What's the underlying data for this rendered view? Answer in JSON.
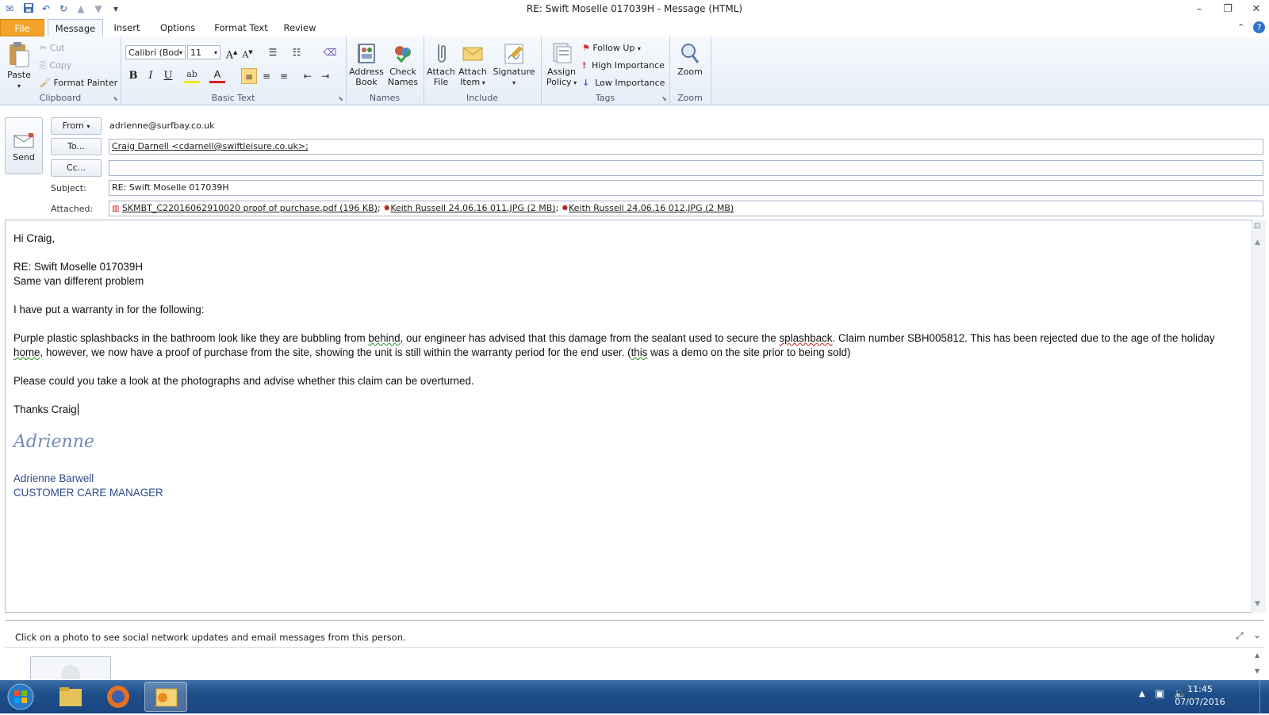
{
  "window": {
    "title": "RE: Swift Moselle 017039H  -  Message (HTML)"
  },
  "ribbon_tabs": [
    {
      "label": "File"
    },
    {
      "label": "Message"
    },
    {
      "label": "Insert"
    },
    {
      "label": "Options"
    },
    {
      "label": "Format Text"
    },
    {
      "label": "Review"
    }
  ],
  "clipboard": {
    "paste": "Paste",
    "cut": "Cut",
    "copy": "Copy",
    "format_painter": "Format Painter",
    "group_label": "Clipboard"
  },
  "basic_text": {
    "font_name": "Calibri (Bod",
    "font_size": "11",
    "bold": "B",
    "italic": "I",
    "underline": "U",
    "group_label": "Basic Text"
  },
  "names": {
    "address_book_1": "Address",
    "address_book_2": "Book",
    "check_names_1": "Check",
    "check_names_2": "Names",
    "group_label": "Names"
  },
  "include": {
    "attach_file_1": "Attach",
    "attach_file_2": "File",
    "attach_item_1": "Attach",
    "attach_item_2": "Item",
    "signature": "Signature",
    "group_label": "Include"
  },
  "tags": {
    "assign_policy_1": "Assign",
    "assign_policy_2": "Policy",
    "follow_up": "Follow Up",
    "high_importance": "High Importance",
    "low_importance": "Low Importance",
    "group_label": "Tags"
  },
  "zoom": {
    "zoom": "Zoom",
    "group_label": "Zoom"
  },
  "header": {
    "send": "Send",
    "from_button": "From",
    "from_value": "adrienne@surfbay.co.uk",
    "to_button": "To...",
    "to_value": "Craig Darnell <cdarnell@swiftleisure.co.uk>;",
    "cc_button": "Cc...",
    "cc_value": "",
    "subject_label": "Subject:",
    "subject_value": "RE: Swift Moselle 017039H",
    "attached_label": "Attached:",
    "attachments": [
      {
        "name": "SKMBT_C22016062910020 proof of purchase.pdf (196 KB)"
      },
      {
        "name": "Keith Russell 24.06.16 011.JPG (2 MB)"
      },
      {
        "name": "Keith Russell 24.06.16 012.JPG (2 MB)"
      }
    ]
  },
  "body": {
    "greeting": "Hi Craig,",
    "ref_line": "RE: Swift Moselle 017039H",
    "subline": "Same van different problem",
    "intro": "I have put a warranty in for the following:",
    "para1_a": "Purple plastic splashbacks in the bathroom look like they are bubbling from ",
    "para1_b": "behind,",
    "para1_c": " our engineer has advised that this damage from the sealant used to secure the ",
    "para1_d": "splashback",
    "para1_e": ".  Claim number SBH005812.  This has been rejected due to the age of the holiday ",
    "para1_f": "home,",
    "para1_g": " however, we now have a proof of purchase from the site, showing the unit is still within the warranty period for the end user.  (",
    "para1_h": "this",
    "para1_i": " was a demo on the site prior to being sold)",
    "para2": "Please could you take a look at the photographs and advise whether this claim can be overturned.",
    "closing": "Thanks Craig",
    "signature_script": "Adrienne",
    "signature_name": "Adrienne Barwell",
    "signature_title": "CUSTOMER CARE MANAGER"
  },
  "people_pane": {
    "message": "Click on a photo to see social network updates and email messages from this person."
  },
  "taskbar": {
    "time": "11:45",
    "date": "07/07/2016"
  }
}
